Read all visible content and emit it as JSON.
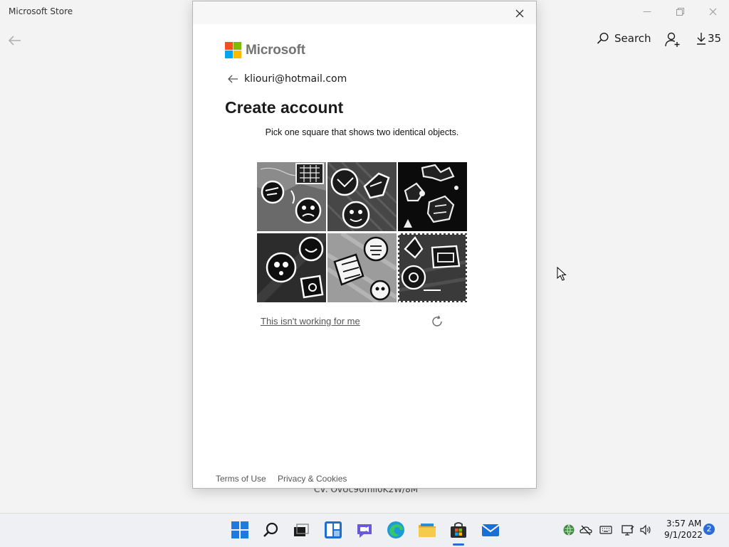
{
  "store": {
    "title": "Microsoft Store",
    "search_label": "Search",
    "downloads_count": "35",
    "cv_text": "CV: OvUc90mll0K2W/8M",
    "window_controls": [
      "minimize-icon",
      "restore-icon",
      "close-icon"
    ]
  },
  "dialog": {
    "logo_text": "Microsoft",
    "logo_colors": [
      "#f25022",
      "#7fba00",
      "#00a4ef",
      "#ffb900"
    ],
    "identity_email": "kliouri@hotmail.com",
    "heading": "Create account",
    "captcha": {
      "instruction": "Pick one square that shows two identical objects.",
      "tiles": [
        {
          "id": 1,
          "selected": false
        },
        {
          "id": 2,
          "selected": false
        },
        {
          "id": 3,
          "selected": false
        },
        {
          "id": 4,
          "selected": false
        },
        {
          "id": 5,
          "selected": false
        },
        {
          "id": 6,
          "selected": true
        }
      ],
      "not_working_link": "This isn't working for me"
    },
    "footer": {
      "terms": "Terms of Use",
      "privacy": "Privacy & Cookies"
    }
  },
  "taskbar": {
    "apps": [
      "start-icon",
      "search-icon",
      "task-view-icon",
      "widgets-icon",
      "chat-icon",
      "edge-icon",
      "file-explorer-icon",
      "store-icon",
      "mail-icon"
    ],
    "active_app": "store-icon",
    "clock_time": "3:57 AM",
    "clock_date": "9/1/2022",
    "notification_count": "2",
    "accent": "#2b6cd6"
  }
}
